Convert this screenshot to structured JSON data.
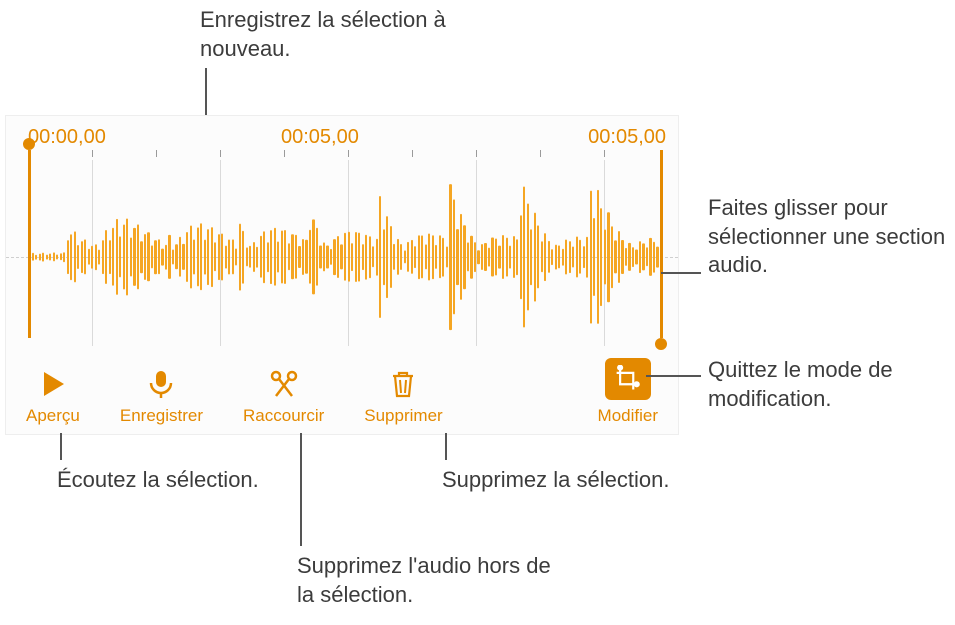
{
  "callouts": {
    "rerecord": "Enregistrez la sélection à nouveau.",
    "drag": "Faites glisser pour sélectionner une section audio.",
    "quit_edit": "Quittez le mode de modification.",
    "listen": "Écoutez la sélection.",
    "delete_sel": "Supprimez la sélection.",
    "delete_out": "Supprimez l'audio hors de la sélection."
  },
  "timecodes": {
    "start": "00:00,00",
    "mid": "00:05,00",
    "end": "00:05,00"
  },
  "tools": {
    "preview": "Aperçu",
    "record": "Enregistrer",
    "trim": "Raccourcir",
    "delete": "Supprimer",
    "edit": "Modifier"
  },
  "colors": {
    "accent": "#f39c12",
    "waveform": "#f5a623"
  }
}
